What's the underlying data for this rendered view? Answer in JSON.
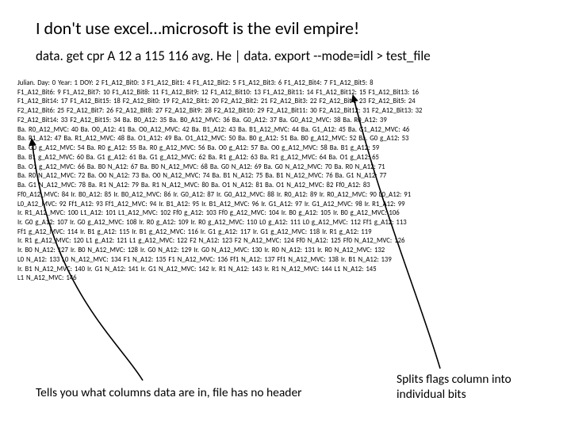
{
  "title": "I don't use excel…microsoft is the evil empire!",
  "command": "data. get cpr A 12 a 115 116 avg. He | data. export --mode=idl  > test_file",
  "rows": [
    "Julian. Day: 0   Year: 1  DOY: 2  F1_A12_Bit0: 3  F1_A12_Bit1: 4  F1_A12_Bit2: 5  F1_A12_Bit3: 6  F1_A12_Bit4: 7  F1_A12_Bit5: 8",
    "F1_A12_Bit6: 9  F1_A12_Bit7: 10  F1_A12_Bit8: 11  F1_A12_Bit9: 12  F1_A12_Bit10: 13  F1_A12_Bit11: 14  F1_A12_Bit12: 15  F1_A12_Bit13: 16",
    "F1_A12_Bit14: 17  F1_A12_Bit15: 18 F2_A12_Bit0: 19  F2_A12_Bit1: 20  F2_A12_Bit2: 21  F2_A12_Bit3: 22  F2_A12_Bit4: 23  F2_A12_Bit5: 24",
    "F2_A12_Bit6: 25  F2_A12_Bit7: 26  F2_A12_Bit8: 27 F2_A12_Bit9: 28  F2_A12_Bit10: 29  F2_A12_Bit11: 30  F2_A12_Bit12: 31  F2_A12_Bit13: 32",
    "F2_A12_Bit14: 33  F2_A12_Bit15: 34  Ba. B0_A12: 35     Ba. B0_A12_MVC: 36 Ba. G0_A12: 37     Ba. G0_A12_MVC: 38  Ba. R0_A12: 39",
    "Ba. R0_A12_MVC: 40  Ba. O0_A12: 41   Ba. O0_A12_MVC: 42  Ba. B1_A12: 43   Ba. B1_A12_MVC: 44  Ba. G1_A12: 45   Ba. G1_A12_MVC: 46",
    "Ba. R1_A12: 47     Ba. R1_A12_MVC: 48  Ba. O1_A12: 49   Ba. O1_A12_MVC: 50  Ba. B0 g_A12: 51   Ba. B0 g_A12_MVC: 52     Ba. G0 g_A12: 53",
    "Ba. G0 g_A12_MVC: 54     Ba. R0 g_A12: 55  Ba. R0 g_A12_MVC: 56     Ba. O0 g_A12: 57  Ba. O0 g_A12_MVC: 58     Ba. B1 g_A12: 59",
    "Ba. B1 g_A12_MVC: 60     Ba. G1 g_A12: 61  Ba. G1 g_A12_MVC: 62     Ba. R1 g_A12: 63  Ba. R1 g_A12_MVC: 64     Ba. O1 g_A12: 65",
    "Ba. O1 g_A12_MVC: 66     Ba. B0 N_A12: 67  Ba. B0 N_A12_MVC: 68     Ba. G0 N_A12: 69  Ba. G0 N_A12_MVC: 70     Ba. R0 N_A12: 71",
    "Ba. R0 N_A12_MVC: 72     Ba. O0 N_A12: 73  Ba. O0 N_A12_MVC: 74     Ba. B1 N_A12: 75  Ba. B1 N_A12_MVC: 76  Ba. G1 N_A12: 77",
    "Ba. G1 N_A12_MVC: 78     Ba. R1 N_A12: 79  Ba. R1 N_A12_MVC: 80     Ba. O1 N_A12: 81  Ba. O1 N_A12_MVC: 82     Ff0_A12: 83",
    "Ff0_A12_MVC: 84  Ir. B0_A12: 85   Ir. B0_A12_MVC: 86  Ir. G0_A12: 87   Ir. G0_A12_MVC: 88  Ir. R0_A12: 89   Ir. R0_A12_MVC: 90 L0_A12: 91",
    "L0_A12_MVC: 92  Ff1_A12: 93     Ff1_A12_MVC: 94  Ir. B1_A12: 95   Ir. B1_A12_MVC: 96  Ir. G1_A12: 97     Ir. G1_A12_MVC: 98  Ir. R1_A12: 99",
    "Ir. R1_A12_MVC: 100     L1_A12: 101   L1_A12_MVC: 102  Ff0 g_A12: 103  Ff0 g_A12_MVC: 104     Ir. B0 g_A12: 105  Ir. B0 g_A12_MVC: 106",
    "Ir. G0 g_A12: 107  Ir. G0 g_A12_MVC: 108   Ir. R0 g_A12: 109  Ir. R0 g_A12_MVC: 110     L0 g_A12: 111  L0 g_A12_MVC: 112  Ff1 g_A12: 113",
    "Ff1 g_A12_MVC: 114     Ir. B1 g_A12: 115  Ir. B1 g_A12_MVC: 116   Ir. G1 g_A12: 117  Ir. G1 g_A12_MVC: 118     Ir. R1 g_A12: 119",
    "Ir. R1 g_A12_MVC: 120     L1 g_A12: 121   L1 g_A12_MVC: 122  F2 N_A12: 123  F2 N_A12_MVC: 124  Ff0 N_A12: 125  Ff0 N_A12_MVC: 126",
    "Ir. B0 N_A12: 127  Ir. B0 N_A12_MVC: 128     Ir. G0 N_A12: 129  Ir. G0 N_A12_MVC: 130   Ir. R0 N_A12: 131  Ir. R0 N_A12_MVC: 132",
    "L0 N_A12: 133     L0 N_A12_MVC: 134  F1 N_A12: 135   F1 N_A12_MVC: 136  Ff1 N_A12: 137   Ff1 N_A12_MVC: 138     Ir. B1 N_A12: 139",
    "Ir. B1 N_A12_MVC: 140     Ir. G1 N_A12: 141  Ir. G1 N_A12_MVC: 142     Ir. R1 N_A12: 143  Ir. R1 N_A12_MVC: 144     L1 N_A12: 145",
    "L1 N_A12_MVC: 146"
  ],
  "footer_left": "Tells you what columns data are in, file has no header",
  "footer_right": "Splits flags column into individual bits"
}
